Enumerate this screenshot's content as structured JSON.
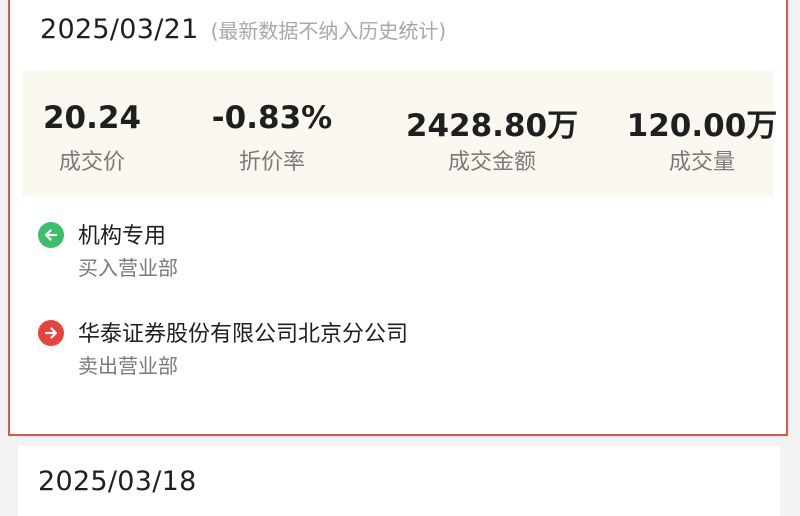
{
  "record1": {
    "date": "2025/03/21",
    "note": "(最新数据不纳入历史统计)",
    "stats": [
      {
        "value": "20.24",
        "label": "成交价"
      },
      {
        "value": "-0.83%",
        "label": "折价率"
      },
      {
        "value": "2428.80万",
        "label": "成交金额"
      },
      {
        "value": "120.00万",
        "label": "成交量"
      }
    ],
    "buyer": {
      "name": "机构专用",
      "role": "买入营业部",
      "icon": "arrow-left-icon",
      "color": "#3cbf6a"
    },
    "seller": {
      "name": "华泰证券股份有限公司北京分公司",
      "role": "卖出营业部",
      "icon": "arrow-right-icon",
      "color": "#e8433a"
    }
  },
  "record2": {
    "date": "2025/03/18"
  },
  "colors": {
    "highlight_border": "#e0574a",
    "stats_background": "#fbf8ef"
  }
}
